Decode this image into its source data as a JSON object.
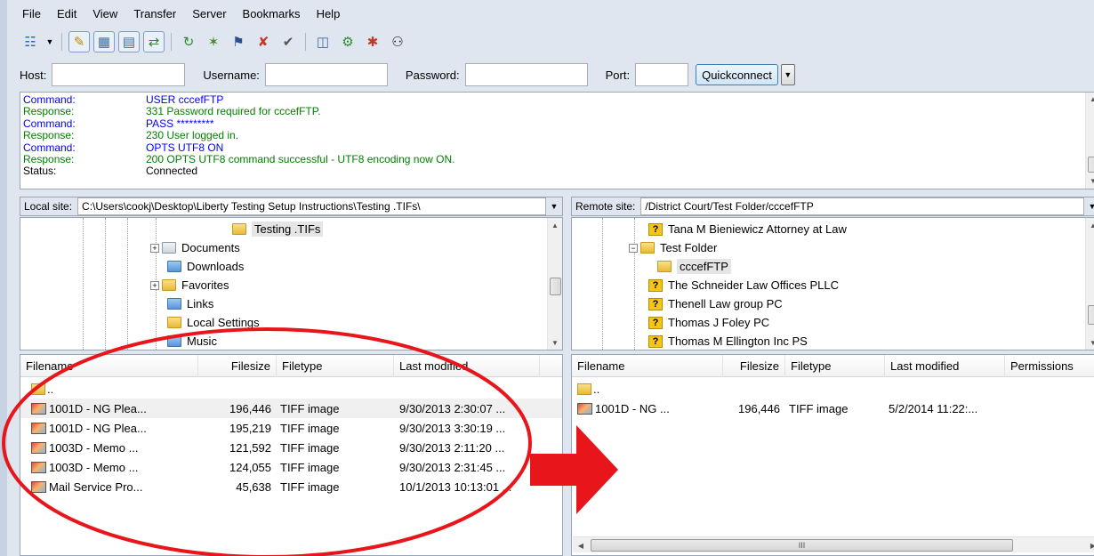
{
  "menu": [
    "File",
    "Edit",
    "View",
    "Transfer",
    "Server",
    "Bookmarks",
    "Help"
  ],
  "toolbar": {
    "icons": [
      "site-manager-icon",
      "dropdown-arrow-icon",
      "toggle-log-icon",
      "toggle-local-tree-icon",
      "toggle-remote-tree-icon",
      "toggle-queue-icon",
      "refresh-icon",
      "process-queue-icon",
      "cancel-icon",
      "disconnect-icon",
      "reconnect-icon",
      "directory-filter-icon",
      "compare-icon",
      "sync-browse-icon",
      "search-icon"
    ]
  },
  "quickconnect": {
    "host_label": "Host:",
    "username_label": "Username:",
    "password_label": "Password:",
    "port_label": "Port:",
    "host_value": "",
    "username_value": "",
    "password_value": "",
    "port_value": "",
    "button_label": "Quickconnect"
  },
  "log": [
    {
      "type": "Command:",
      "msg": "USER cccefFTP",
      "kind": "cmd"
    },
    {
      "type": "Response:",
      "msg": "331 Password required for cccefFTP.",
      "kind": "resp"
    },
    {
      "type": "Command:",
      "msg": "PASS *********",
      "kind": "cmd"
    },
    {
      "type": "Response:",
      "msg": "230 User logged in.",
      "kind": "resp"
    },
    {
      "type": "Command:",
      "msg": "OPTS UTF8 ON",
      "kind": "cmd"
    },
    {
      "type": "Response:",
      "msg": "200 OPTS UTF8 command successful - UTF8 encoding now ON.",
      "kind": "resp"
    },
    {
      "type": "Status:",
      "msg": "Connected",
      "kind": "status"
    }
  ],
  "local": {
    "site_label": "Local site:",
    "site_path": "C:\\Users\\cookj\\Desktop\\Liberty Testing Setup Instructions\\Testing .TIFs\\",
    "tree": [
      {
        "label": "Testing .TIFs",
        "icon": "folder",
        "selected": true
      },
      {
        "label": "Documents",
        "icon": "doc",
        "expander": "+"
      },
      {
        "label": "Downloads",
        "icon": "blue"
      },
      {
        "label": "Favorites",
        "icon": "star",
        "expander": "+"
      },
      {
        "label": "Links",
        "icon": "blue"
      },
      {
        "label": "Local Settings",
        "icon": "folder"
      },
      {
        "label": "Music",
        "icon": "blue"
      }
    ],
    "headers": {
      "filename": "Filename",
      "filesize": "Filesize",
      "filetype": "Filetype",
      "modified": "Last modified"
    },
    "files": [
      {
        "name": "..",
        "size": "",
        "type": "",
        "modified": "",
        "up": true
      },
      {
        "name": "1001D - NG Plea...",
        "size": "196,446",
        "type": "TIFF image",
        "modified": "9/30/2013 2:30:07 ..."
      },
      {
        "name": "1001D - NG Plea...",
        "size": "195,219",
        "type": "TIFF image",
        "modified": "9/30/2013 3:30:19 ..."
      },
      {
        "name": "1003D - Memo ...",
        "size": "121,592",
        "type": "TIFF image",
        "modified": "9/30/2013 2:11:20 ..."
      },
      {
        "name": "1003D - Memo ...",
        "size": "124,055",
        "type": "TIFF image",
        "modified": "9/30/2013 2:31:45 ..."
      },
      {
        "name": "Mail Service Pro...",
        "size": "45,638",
        "type": "TIFF image",
        "modified": "10/1/2013 10:13:01 ..."
      }
    ]
  },
  "remote": {
    "site_label": "Remote site:",
    "site_path": "/District Court/Test Folder/cccefFTP",
    "tree": [
      {
        "label": "Tana M Bieniewicz Attorney at Law",
        "icon": "unknown"
      },
      {
        "label": "Test Folder",
        "icon": "folder",
        "expander": "−"
      },
      {
        "label": "cccefFTP",
        "icon": "folder",
        "selected": true
      },
      {
        "label": "The Schneider Law Offices PLLC",
        "icon": "unknown"
      },
      {
        "label": "Thenell Law group PC",
        "icon": "unknown"
      },
      {
        "label": "Thomas J Foley PC",
        "icon": "unknown"
      },
      {
        "label": "Thomas M Ellington Inc PS",
        "icon": "unknown"
      }
    ],
    "headers": {
      "filename": "Filename",
      "filesize": "Filesize",
      "filetype": "Filetype",
      "modified": "Last modified",
      "permissions": "Permissions"
    },
    "files": [
      {
        "name": "..",
        "size": "",
        "type": "",
        "modified": "",
        "up": true
      },
      {
        "name": "1001D - NG ...",
        "size": "196,446",
        "type": "TIFF image",
        "modified": "5/2/2014 11:22:..."
      }
    ],
    "hscroll_grip": "III"
  },
  "annotation": {
    "ellipse_color": "#e8161b",
    "arrow_color": "#e8161b"
  }
}
